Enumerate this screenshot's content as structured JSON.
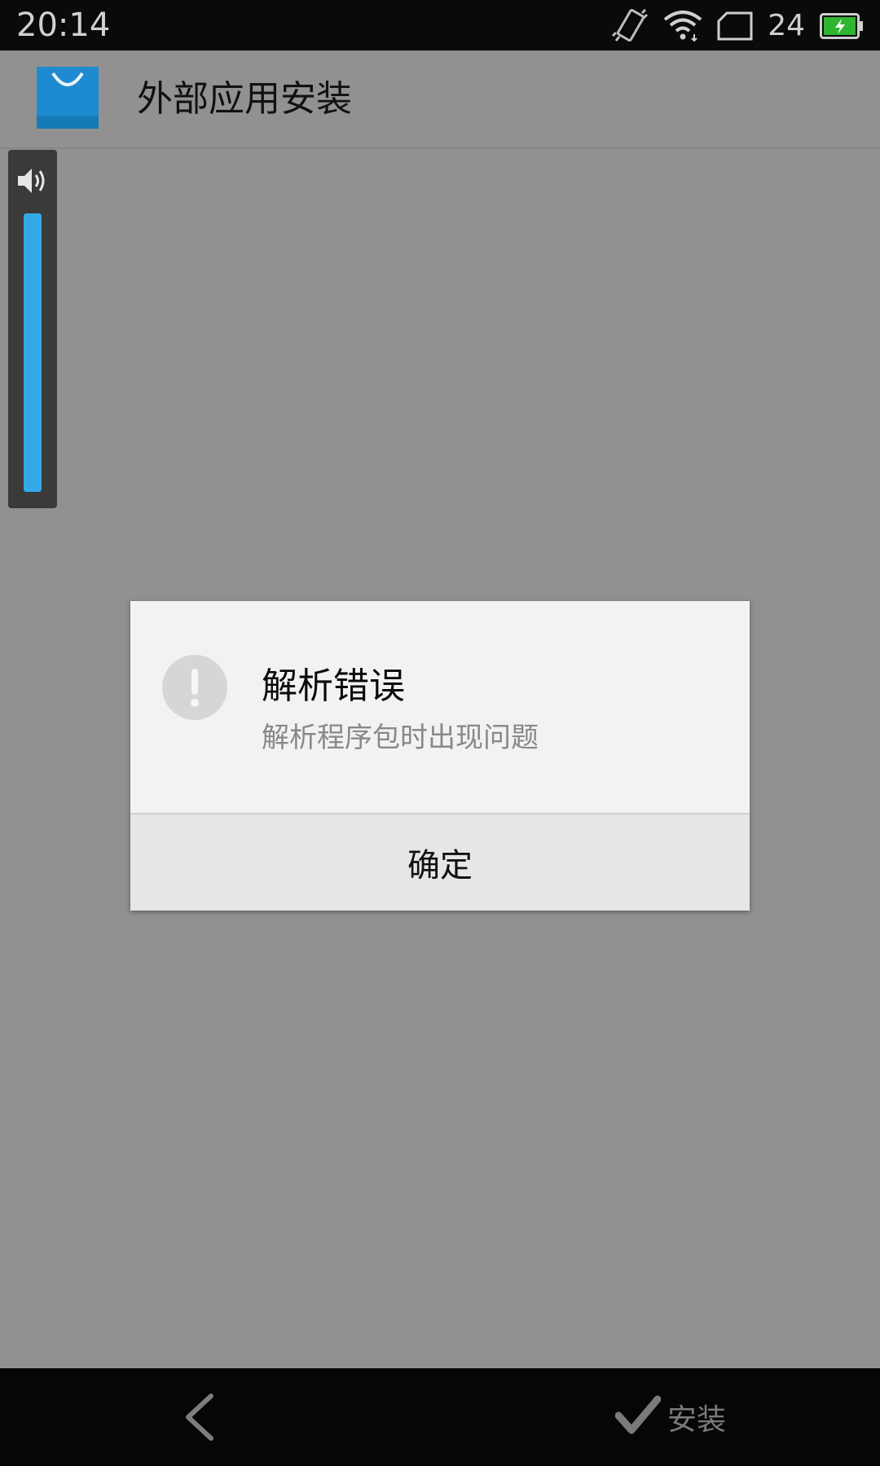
{
  "status_bar": {
    "time": "20:14",
    "icons": [
      "vibrate-icon",
      "wifi-icon",
      "sim-card-icon",
      "battery-charging-icon"
    ],
    "signal_text": "24",
    "battery_color": "#2fb52f"
  },
  "header": {
    "app_icon": "app-store-bag-icon",
    "title": "外部应用安装",
    "accent": "#1e8bd0"
  },
  "volume": {
    "icon": "speaker-icon",
    "level": 1.0,
    "color": "#33a9e8"
  },
  "dialog": {
    "icon": "exclamation-icon",
    "title": "解析错误",
    "message": "解析程序包时出现问题",
    "button_label": "确定"
  },
  "bottom_bar": {
    "back_icon": "chevron-left-icon",
    "install_icon": "check-icon",
    "install_label": "安装"
  }
}
